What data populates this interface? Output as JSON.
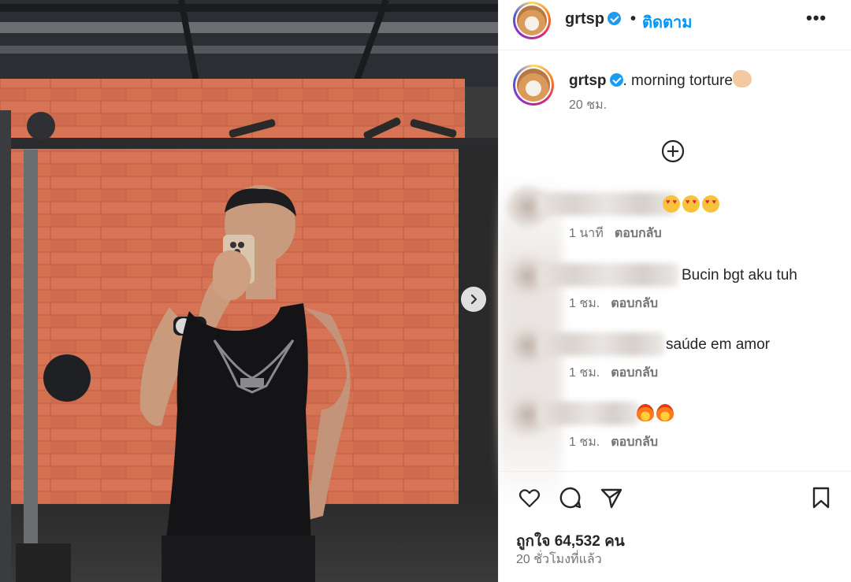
{
  "header": {
    "username": "grtsp",
    "separator": "•",
    "follow_label": "ติดตาม",
    "more_label": "•••"
  },
  "caption": {
    "username": "grtsp",
    "text": ". morning torture",
    "time": "20 ชม."
  },
  "comments": [
    {
      "text": "",
      "emojis": [
        "heart-eyes-emoji",
        "heart-eyes-emoji",
        "heart-eyes-emoji"
      ],
      "time": "1 นาที",
      "reply": "ตอบกลับ"
    },
    {
      "text": "Bucin bgt aku tuh",
      "emojis": [],
      "time": "1 ชม.",
      "reply": "ตอบกลับ"
    },
    {
      "text": "saúde em amor",
      "emojis": [],
      "time": "1 ชม.",
      "reply": "ตอบกลับ"
    },
    {
      "text": "",
      "emojis": [
        "fire-emoji",
        "fire-emoji"
      ],
      "time": "1 ชม.",
      "reply": "ตอบกลับ"
    }
  ],
  "footer": {
    "likes": "ถูกใจ 64,532 คน",
    "ago": "20 ชั่วโมงที่แล้ว"
  },
  "icons": {
    "follow_color": "#0095f6",
    "verified_color": "#1d9bf0",
    "caption_emoji": "flexed-biceps-emoji"
  }
}
